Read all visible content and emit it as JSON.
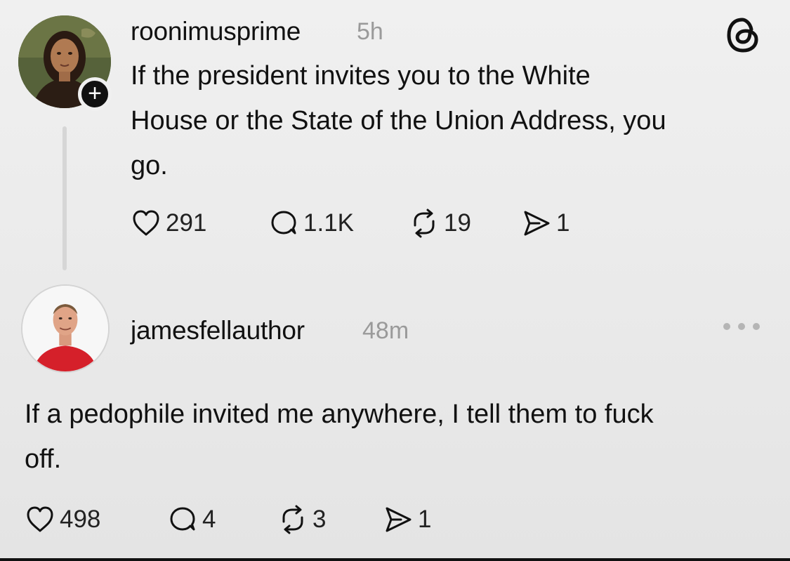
{
  "post1": {
    "username": "roonimusprime",
    "time": "5h",
    "text_lines": [
      "If the president invites you to the White",
      "House or the State of the Union Address, you",
      "go."
    ],
    "likes": "291",
    "replies": "1.1K",
    "reposts": "19",
    "shares": "1",
    "follow_symbol": "+"
  },
  "post2": {
    "username": "jamesfellauthor",
    "time": "48m",
    "text_lines": [
      "If a pedophile invited me anywhere, I tell them to fuck",
      "off."
    ],
    "likes": "498",
    "replies": "4",
    "reposts": "3",
    "shares": "1"
  },
  "icons": {
    "threads_logo": "threads-logo-icon",
    "like": "heart-icon",
    "reply": "comment-bubble-icon",
    "repost": "repost-arrows-icon",
    "share": "share-send-icon",
    "more": "more-dots-icon"
  },
  "colors": {
    "background": "#ebebeb",
    "text": "#111111",
    "muted": "#9a9a9a"
  }
}
